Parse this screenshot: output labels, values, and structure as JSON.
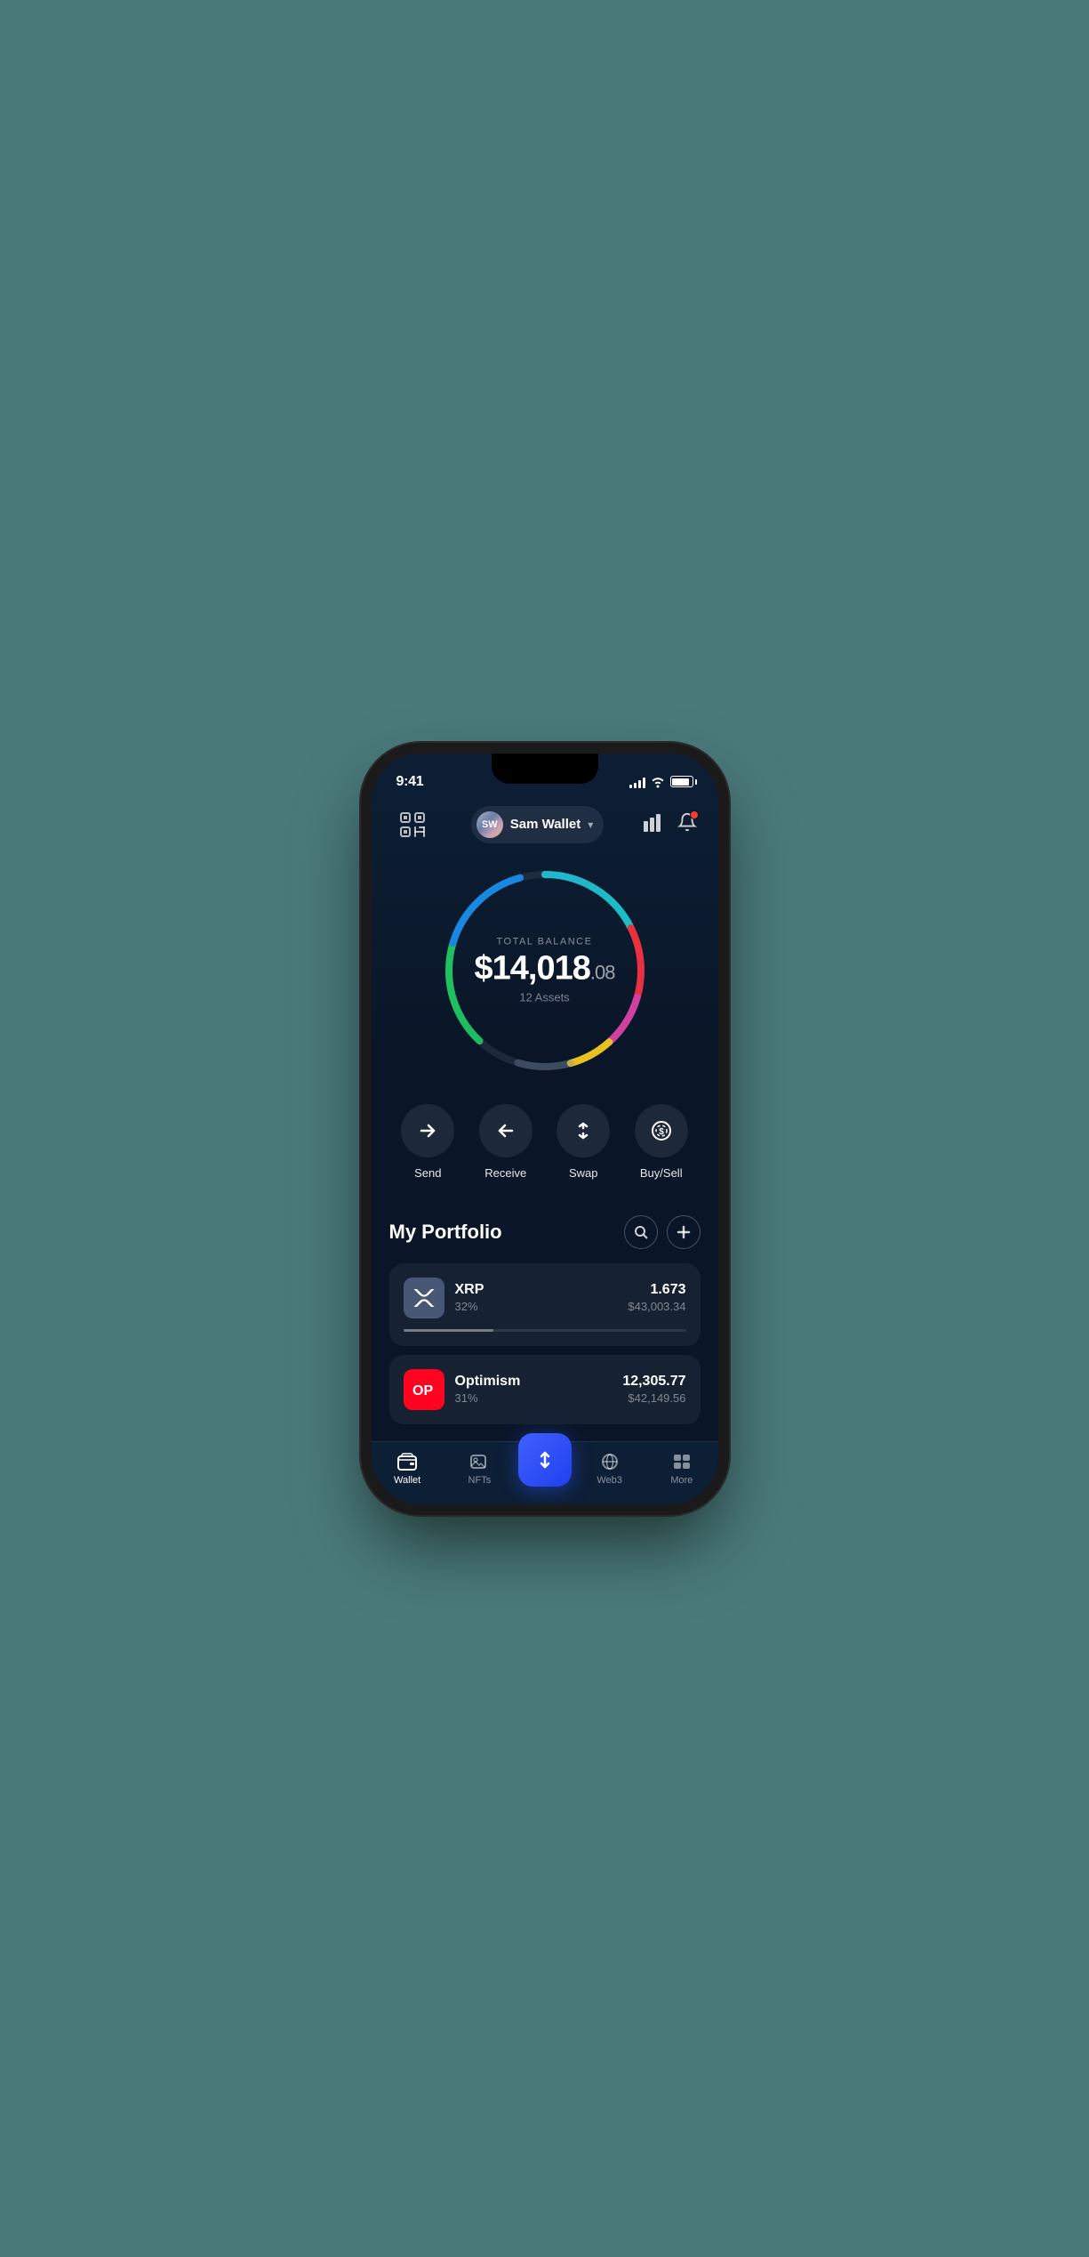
{
  "statusBar": {
    "time": "9:41",
    "signalBars": [
      4,
      6,
      8,
      10,
      12
    ],
    "battery": "full"
  },
  "header": {
    "scanIcon": "scan-icon",
    "wallet": {
      "initials": "SW",
      "name": "Sam Wallet",
      "chevron": "▾"
    },
    "chartIcon": "📊",
    "bellIcon": "🔔"
  },
  "balance": {
    "label": "TOTAL BALANCE",
    "amount": "$14,018",
    "cents": ".08",
    "assetsCount": "12 Assets"
  },
  "actions": [
    {
      "label": "Send",
      "icon": "→"
    },
    {
      "label": "Receive",
      "icon": "←"
    },
    {
      "label": "Swap",
      "icon": "⇅"
    },
    {
      "label": "Buy/Sell",
      "icon": "$"
    }
  ],
  "portfolio": {
    "title": "My Portfolio",
    "searchLabel": "🔍",
    "addLabel": "+"
  },
  "assets": [
    {
      "symbol": "XRP",
      "name": "XRP",
      "percent": "32%",
      "amount": "1.673",
      "usd": "$43,003.34",
      "progressWidth": "32",
      "iconType": "xrp"
    },
    {
      "symbol": "OP",
      "name": "Optimism",
      "percent": "31%",
      "amount": "12,305.77",
      "usd": "$42,149.56",
      "progressWidth": "31",
      "iconType": "op"
    }
  ],
  "bottomNav": [
    {
      "label": "Wallet",
      "icon": "wallet",
      "active": true
    },
    {
      "label": "NFTs",
      "icon": "nfts",
      "active": false
    },
    {
      "label": "",
      "icon": "center",
      "active": false,
      "isCenter": true
    },
    {
      "label": "Web3",
      "icon": "web3",
      "active": false
    },
    {
      "label": "More",
      "icon": "more",
      "active": false
    }
  ]
}
